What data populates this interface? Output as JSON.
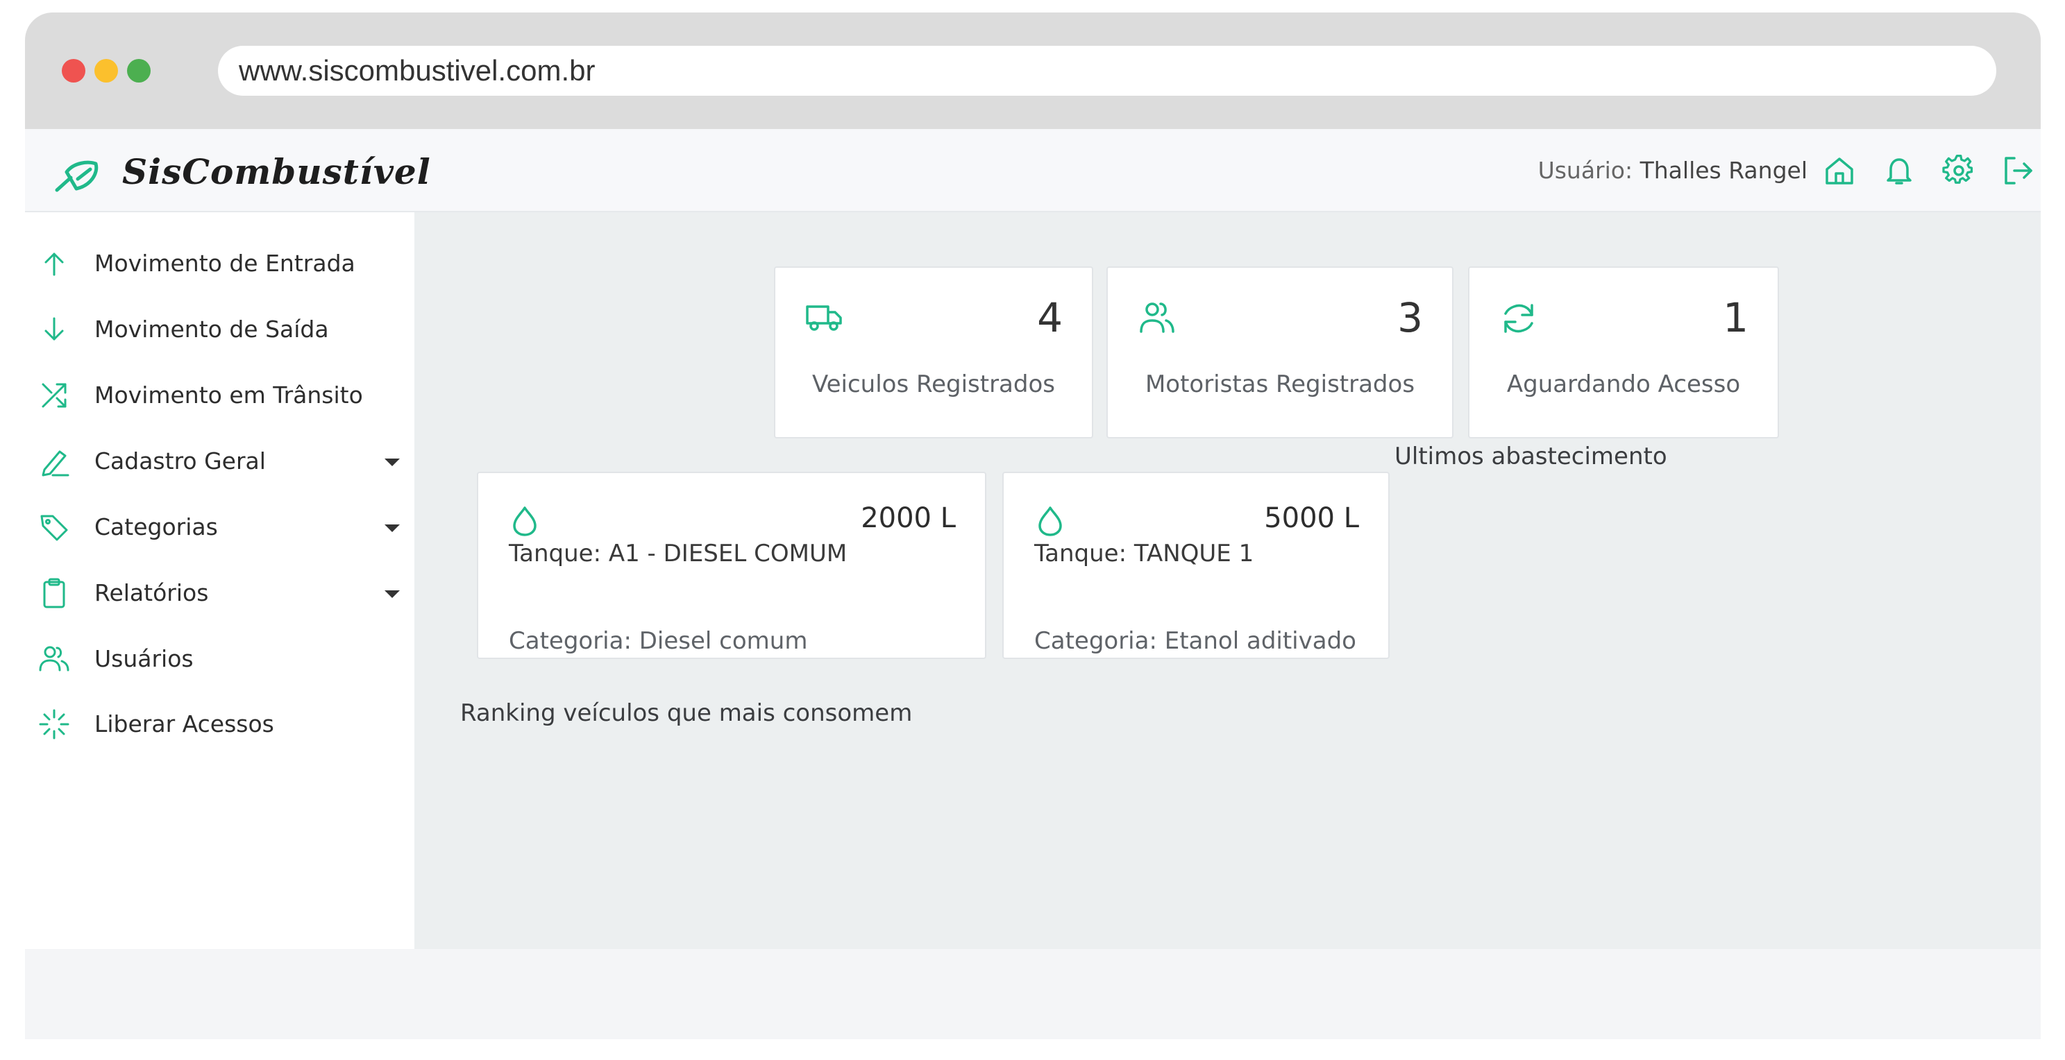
{
  "browser": {
    "url": "www.siscombustivel.com.br"
  },
  "app": {
    "brand": "SisCombustível",
    "user_prefix": "Usuário:",
    "user_name": "Thalles Rangel"
  },
  "colors": {
    "accent": "#20b98a",
    "sidebar_bg": "#ffffff",
    "main_bg": "#eceff0"
  },
  "sidebar": {
    "items": [
      {
        "label": "Movimento de Entrada",
        "icon": "arrow-up-icon",
        "has_dropdown": false
      },
      {
        "label": "Movimento de Saída",
        "icon": "arrow-down-icon",
        "has_dropdown": false
      },
      {
        "label": "Movimento em Trânsito",
        "icon": "shuffle-icon",
        "has_dropdown": false
      },
      {
        "label": "Cadastro Geral",
        "icon": "pencil-icon",
        "has_dropdown": true
      },
      {
        "label": "Categorias",
        "icon": "tag-icon",
        "has_dropdown": true
      },
      {
        "label": "Relatórios",
        "icon": "clipboard-icon",
        "has_dropdown": true
      },
      {
        "label": "Usuários",
        "icon": "users-icon",
        "has_dropdown": false
      },
      {
        "label": "Liberar Acessos",
        "icon": "loader-icon",
        "has_dropdown": false
      }
    ]
  },
  "stats": [
    {
      "value": "4",
      "label": "Veiculos Registrados",
      "icon": "truck-icon"
    },
    {
      "value": "3",
      "label": "Motoristas Registrados",
      "icon": "users-icon"
    },
    {
      "value": "1",
      "label": "Aguardando Acesso",
      "icon": "refresh-icon"
    }
  ],
  "sections": {
    "last_fuelings": "Ultimos abastecimento",
    "ranking": "Ranking veículos que mais consomem"
  },
  "tanks": [
    {
      "amount": "2000 L",
      "name": "Tanque: A1 - DIESEL COMUM",
      "category": "Categoria: Diesel comum",
      "icon": "droplet-icon"
    },
    {
      "amount": "5000 L",
      "name": "Tanque: TANQUE 1",
      "category": "Categoria: Etanol aditivado",
      "icon": "droplet-icon"
    }
  ]
}
